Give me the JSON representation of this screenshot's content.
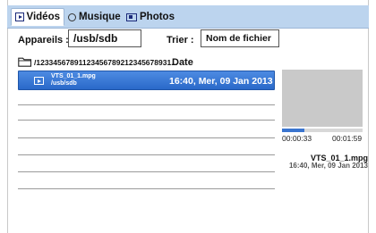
{
  "tabs": [
    {
      "label": "Vidéos",
      "icon": "video-icon",
      "active": true
    },
    {
      "label": "Musique",
      "icon": "music-icon",
      "active": false
    },
    {
      "label": "Photos",
      "icon": "photo-icon",
      "active": false
    }
  ],
  "filters": {
    "devices_label": "Appareils :",
    "devices_value": "/usb/sdb",
    "sort_label": "Trier :",
    "sort_value": "Nom de fichier"
  },
  "browser": {
    "folder_icon": "folder-icon",
    "current_path": "/12334567891123456789212345678931...",
    "date_header": "Date"
  },
  "files": [
    {
      "name": "VTS_01_1.mpg",
      "path": "/usb/sdb",
      "date": "16:40, Mer, 09 Jan 2013",
      "selected": true,
      "icon": "play-icon"
    }
  ],
  "preview": {
    "elapsed": "00:00:33",
    "duration": "00:01:59",
    "progress_fraction": 0.28,
    "file_name": "VTS_01_1.mpg",
    "file_date": "16:40, Mer, 09 Jan 2013"
  },
  "colors": {
    "tabbar": "#bcd4ee",
    "selection": "#2a69c9",
    "accent": "#3a75cf"
  }
}
